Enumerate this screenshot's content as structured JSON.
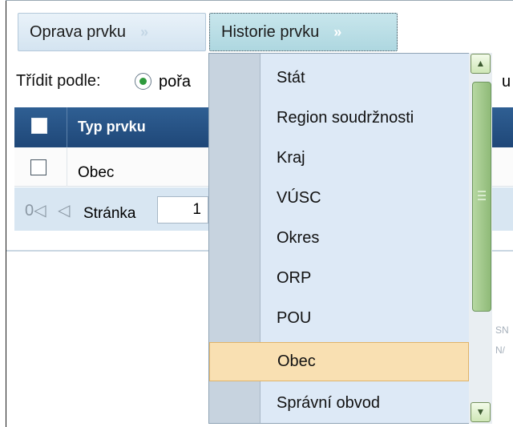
{
  "tabs": [
    {
      "label": "Oprava prvku",
      "arrow": "»"
    },
    {
      "label": "Historie prvku",
      "arrow": "»"
    }
  ],
  "sort": {
    "label": "Třídit podle:",
    "option_visible": "pořa",
    "trailing_fragment": "u"
  },
  "grid": {
    "header": {
      "column_label": "Typ prvku"
    },
    "rows": [
      {
        "label": "Obec"
      }
    ],
    "pager": {
      "first_icon": "0◁",
      "prev_icon": "◁",
      "label": "Stránka",
      "page_value": "1"
    }
  },
  "background_fragments": [
    "SN",
    "N/"
  ],
  "dropdown": {
    "items": [
      "Stát",
      "Region soudržnosti",
      "Kraj",
      "VÚSC",
      "Okres",
      "ORP",
      "POU",
      "Obec",
      "Správní obvod"
    ],
    "highlighted": "Obec"
  },
  "scrollbar": {
    "up_icon": "▲",
    "down_icon": "▼"
  }
}
